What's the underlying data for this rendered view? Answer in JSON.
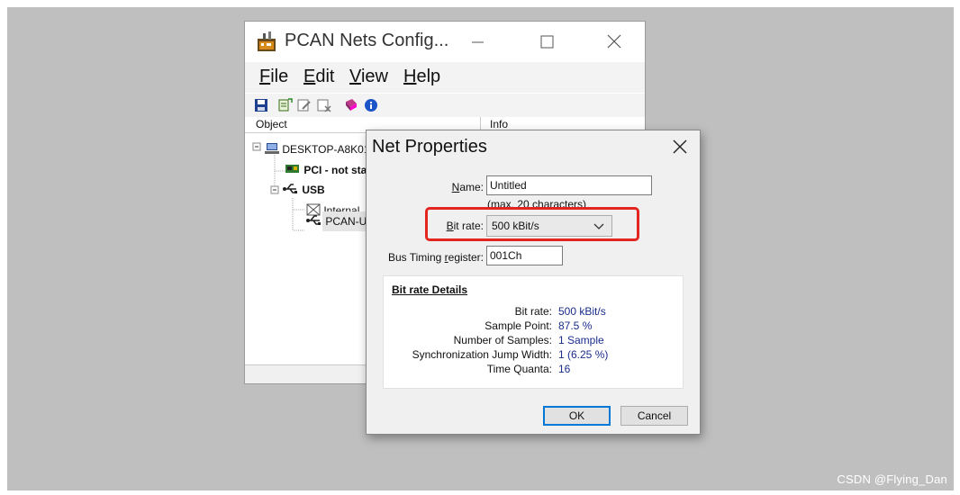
{
  "main_window": {
    "title": "PCAN Nets Config...",
    "menu": [
      {
        "label": "File",
        "accel": "F",
        "rest": "ile"
      },
      {
        "label": "Edit",
        "accel": "E",
        "rest": "dit"
      },
      {
        "label": "View",
        "accel": "V",
        "rest": "iew"
      },
      {
        "label": "Help",
        "accel": "H",
        "rest": "elp"
      }
    ],
    "columns": {
      "object": "Object",
      "info": "Info"
    },
    "tree": [
      {
        "label": "DESKTOP-A8K01",
        "icon": "computer-icon"
      },
      {
        "label": "PCI - not sta",
        "icon": "pci-card-icon"
      },
      {
        "label": "USB",
        "icon": "usb-icon"
      },
      {
        "label": "Internal",
        "icon": "internal-net-icon"
      },
      {
        "label": "PCAN-U",
        "icon": "usb-device-icon"
      }
    ]
  },
  "dialog": {
    "title": "Net Properties",
    "name_label": {
      "accel": "N",
      "rest": "ame:"
    },
    "name_value": "Untitled",
    "name_hint": "(max. 20 characters)",
    "bitrate_label": {
      "accel": "B",
      "rest": "it rate:"
    },
    "bitrate_value": "500 kBit/s",
    "btr_label": {
      "pre": "Bus Timing ",
      "accel": "r",
      "rest": "egister:"
    },
    "btr_value": "001Ch",
    "details": {
      "title": "Bit rate Details",
      "rows": [
        {
          "key": "Bit rate:",
          "value": "500 kBit/s"
        },
        {
          "key": "Sample Point:",
          "value": "87.5 %"
        },
        {
          "key": "Number of Samples:",
          "value": "1 Sample"
        },
        {
          "key": "Synchronization Jump Width:",
          "value": "1 (6.25 %)"
        },
        {
          "key": "Time Quanta:",
          "value": "16"
        }
      ]
    },
    "ok_label": "OK",
    "cancel_label": "Cancel"
  },
  "watermark": "CSDN @Flying_Dan",
  "colors": {
    "highlight": "#e4241f",
    "value_text": "#1a2c8c",
    "focus": "#0078d7"
  }
}
